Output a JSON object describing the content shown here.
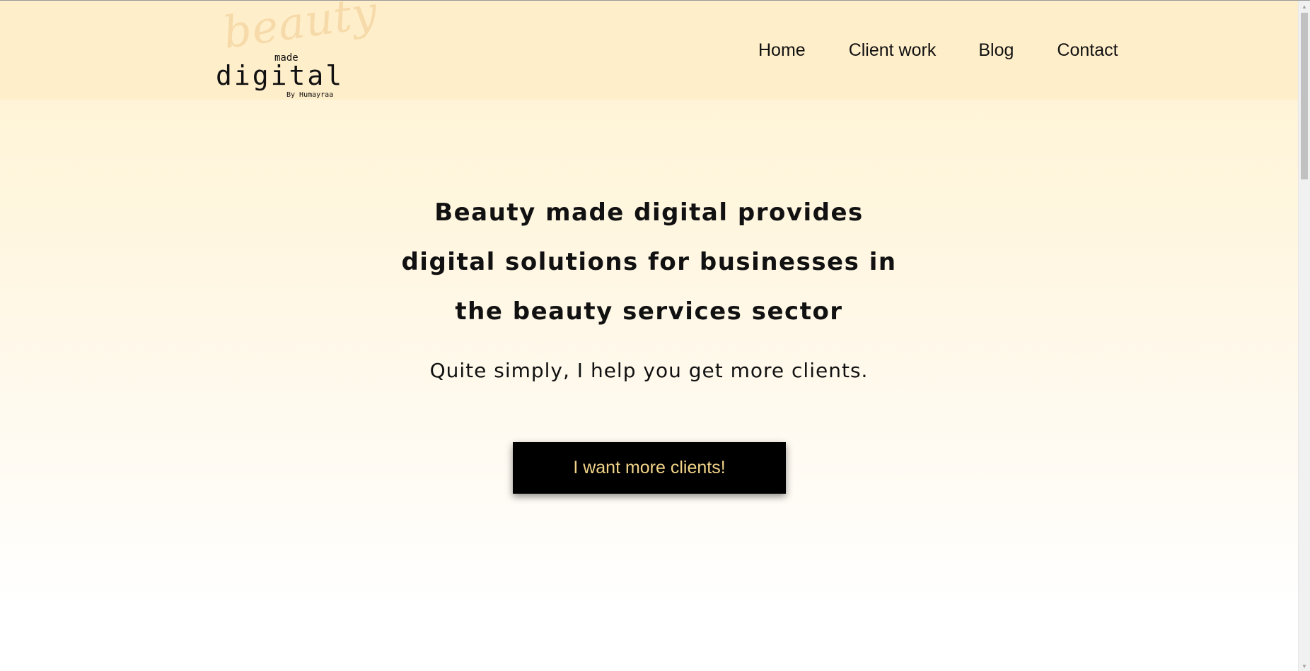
{
  "logo": {
    "script_word": "beauty",
    "made": "made",
    "digital": "digital",
    "byline": "By Humayraa"
  },
  "nav": {
    "items": [
      {
        "label": "Home"
      },
      {
        "label": "Client work"
      },
      {
        "label": "Blog"
      },
      {
        "label": "Contact"
      }
    ]
  },
  "hero": {
    "headline": "Beauty made digital provides digital solutions for businesses in the beauty services sector",
    "subline": "Quite simply, I help you get more clients.",
    "cta_label": "I want more clients!"
  },
  "colors": {
    "header_bg": "#ffeeca",
    "cta_bg": "#000000",
    "cta_text": "#f3d58a",
    "logo_script": "#f6d9a8"
  },
  "icons": {
    "scroll_up": "triangle-up-icon",
    "scroll_down": "triangle-down-icon"
  }
}
